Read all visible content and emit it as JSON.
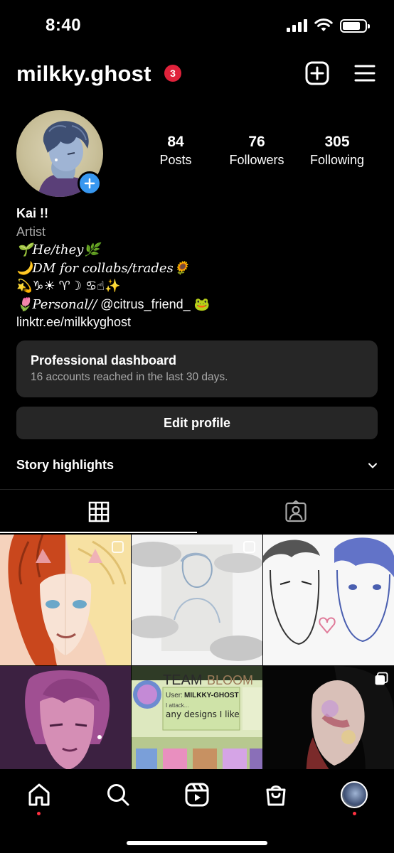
{
  "status_bar": {
    "time": "8:40"
  },
  "header": {
    "username": "milkky.ghost",
    "notification_count": "3"
  },
  "profile": {
    "stats": [
      {
        "value": "84",
        "label": "Posts"
      },
      {
        "value": "76",
        "label": "Followers"
      },
      {
        "value": "305",
        "label": "Following"
      }
    ],
    "name": "Kai !!",
    "category": "Artist",
    "bio_lines": [
      "🌱He/they🌿",
      "🌙DM for collabs/trades🌻",
      "💫♑☀ ♈☽ ♋☝✨",
      "🌷Personal//",
      "@citrus_friend_",
      "🐸"
    ],
    "link": "linktr.ee/milkkyghost"
  },
  "dashboard": {
    "title": "Professional dashboard",
    "subtitle": "16 accounts reached in the last 30 days."
  },
  "buttons": {
    "edit_profile": "Edit profile"
  },
  "highlights": {
    "title": "Story highlights"
  },
  "posts": {
    "team_label": "TEAM",
    "team_name": "BLOOM",
    "user_label": "User:",
    "user_value": "MILKKY-GHOST",
    "attack_label": "I attack...",
    "attack_text": "any designs I like"
  },
  "colors": {
    "accent": "#3797f0",
    "badge": "#e0223b",
    "surface": "#262626",
    "muted": "#a8a8a8"
  }
}
